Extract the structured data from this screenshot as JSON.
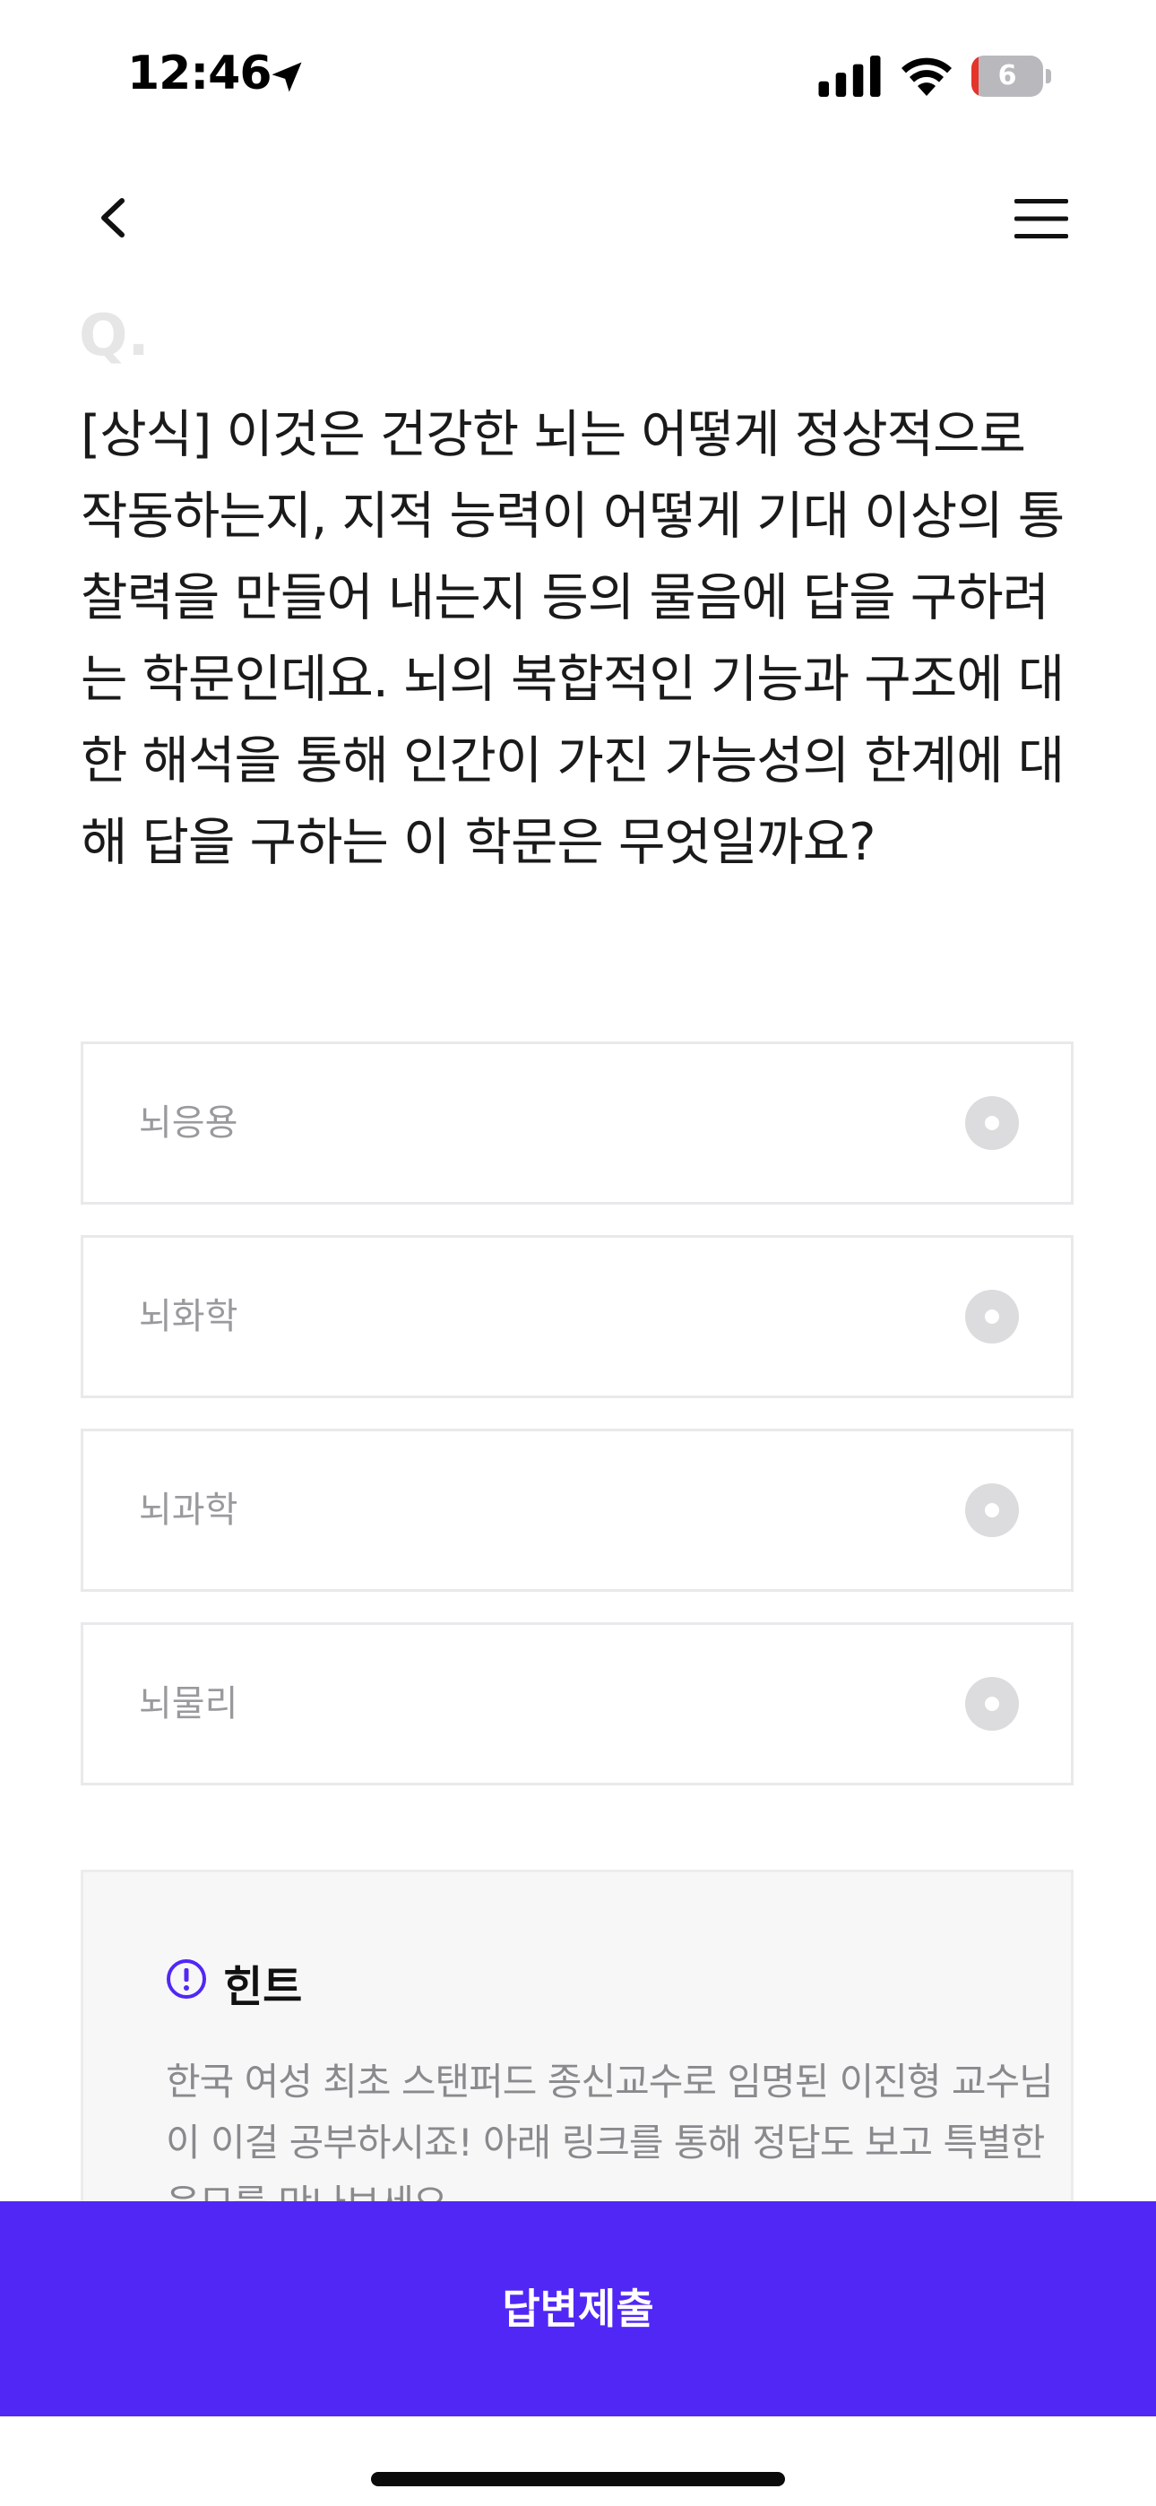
{
  "status_bar": {
    "time": "12:46",
    "battery_level": "6",
    "battery_fraction": 0.06,
    "icons": [
      "location-arrow-icon",
      "cellular-signal-icon",
      "wifi-icon",
      "battery-icon"
    ]
  },
  "nav": {
    "icons": [
      "chevron-left-icon",
      "hamburger-menu-icon"
    ]
  },
  "question": {
    "marker": "Q.",
    "text": "[상식] 이것은 건강한 뇌는 어떻게 정상적으로 작동하는지, 지적 능력이 어떻게 기대 이상의 통찰력을 만들어 내는지 등의 물음에 답을 구하려는 학문인데요. 뇌의 복합적인 기능과 구조에 대한 해석을 통해 인간이 가진 가능성의 한계에 대해 답을 구하는 이 학문은 무엇일까요?"
  },
  "options": [
    {
      "label": "뇌응용"
    },
    {
      "label": "뇌화학"
    },
    {
      "label": "뇌과학"
    },
    {
      "label": "뇌물리"
    }
  ],
  "hint": {
    "title": "힌트",
    "icon": "exclamation-circle-icon",
    "text": "한국 여성 최초 스탠퍼드 종신교수로 임명된 이진형 교수님이 이걸 공부하시죠! 아래 링크를 통해 정답도 보고 특별한 응모를 만나보세요"
  },
  "submit": {
    "label": "답변제출"
  },
  "colors": {
    "accent": "#5127f6",
    "battery_low": "#e5342a"
  }
}
